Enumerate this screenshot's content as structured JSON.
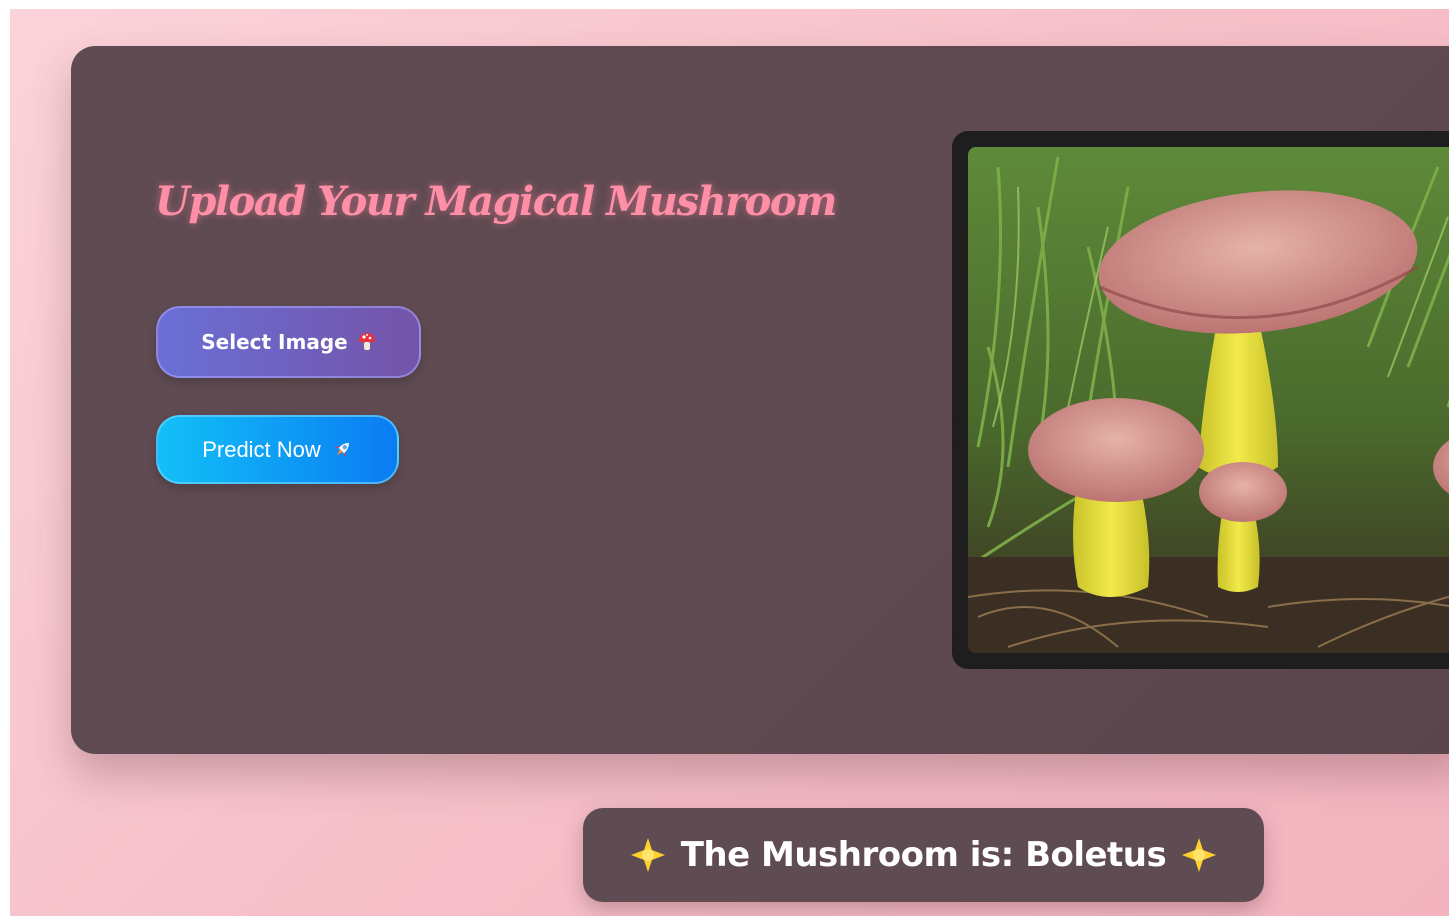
{
  "upload": {
    "title": "Upload Your Magical Mushroom"
  },
  "buttons": {
    "select_label": "Select Image",
    "select_icon": "mushroom-icon",
    "predict_label": "Predict Now",
    "predict_icon": "rocket-icon"
  },
  "preview": {
    "image": "mushroom-photo"
  },
  "result": {
    "text": "The Mushroom is: Boletus",
    "icon": "sparkle-icon"
  },
  "colors": {
    "page_background": "#f7c4cd",
    "panel": "#5f4b52",
    "title": "#ff8fa6",
    "select_button": "#6a6fd6",
    "predict_button": "#0a9cf5"
  }
}
